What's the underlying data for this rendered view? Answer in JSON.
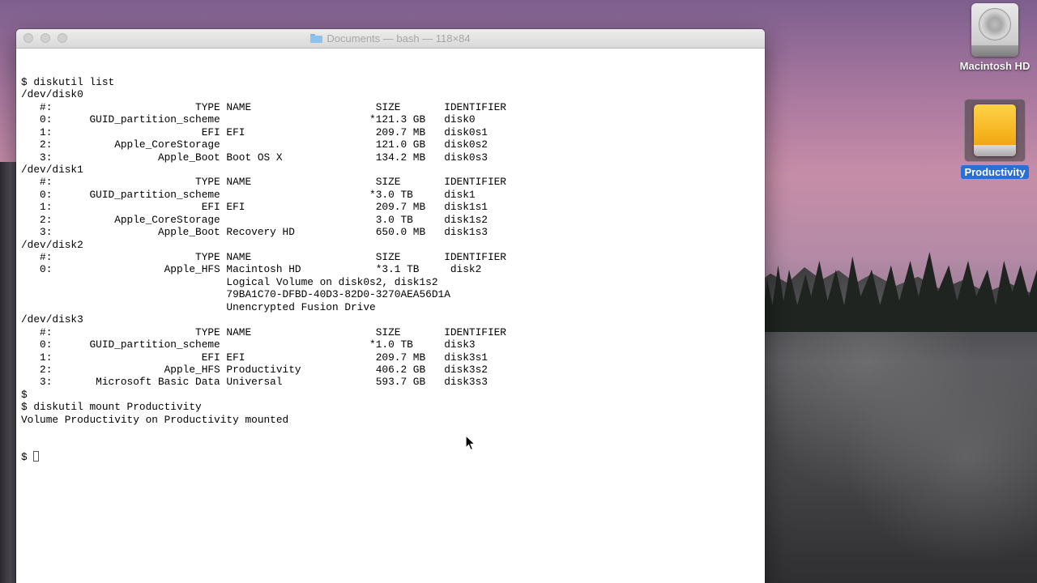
{
  "window": {
    "title": "Documents — bash — 118×84",
    "folder_icon": "folder-icon"
  },
  "terminal": {
    "lines": [
      "$ diskutil list",
      "/dev/disk0",
      "   #:                       TYPE NAME                    SIZE       IDENTIFIER",
      "   0:      GUID_partition_scheme                        *121.3 GB   disk0",
      "   1:                        EFI EFI                     209.7 MB   disk0s1",
      "   2:          Apple_CoreStorage                         121.0 GB   disk0s2",
      "   3:                 Apple_Boot Boot OS X               134.2 MB   disk0s3",
      "/dev/disk1",
      "   #:                       TYPE NAME                    SIZE       IDENTIFIER",
      "   0:      GUID_partition_scheme                        *3.0 TB     disk1",
      "   1:                        EFI EFI                     209.7 MB   disk1s1",
      "   2:          Apple_CoreStorage                         3.0 TB     disk1s2",
      "   3:                 Apple_Boot Recovery HD             650.0 MB   disk1s3",
      "/dev/disk2",
      "   #:                       TYPE NAME                    SIZE       IDENTIFIER",
      "   0:                  Apple_HFS Macintosh HD            *3.1 TB     disk2",
      "                                 Logical Volume on disk0s2, disk1s2",
      "                                 79BA1C70-DFBD-40D3-82D0-3270AEA56D1A",
      "                                 Unencrypted Fusion Drive",
      "/dev/disk3",
      "   #:                       TYPE NAME                    SIZE       IDENTIFIER",
      "   0:      GUID_partition_scheme                        *1.0 TB     disk3",
      "   1:                        EFI EFI                     209.7 MB   disk3s1",
      "   2:                  Apple_HFS Productivity            406.2 GB   disk3s2",
      "   3:       Microsoft Basic Data Universal               593.7 GB   disk3s3",
      "$",
      "$ diskutil mount Productivity",
      "Volume Productivity on Productivity mounted"
    ],
    "prompt": "$ "
  },
  "desktop_icons": {
    "macintosh_hd": {
      "label": "Macintosh HD",
      "icon": "hard-drive-icon"
    },
    "productivity": {
      "label": "Productivity",
      "icon": "external-drive-icon",
      "selected": true
    }
  },
  "colors": {
    "selection_label": "#2a6fd6",
    "drive_yellow": "#f5b21c"
  }
}
